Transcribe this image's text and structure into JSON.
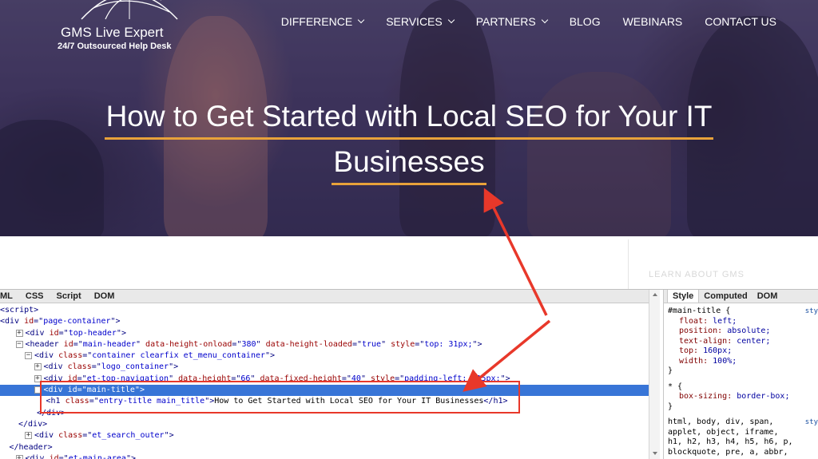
{
  "hero": {
    "logo": {
      "name": "GMS Live Expert",
      "tagline": "24/7 Outsourced Help Desk"
    },
    "nav": [
      {
        "label": "DIFFERENCE",
        "dropdown": true
      },
      {
        "label": "SERVICES",
        "dropdown": true
      },
      {
        "label": "PARTNERS",
        "dropdown": true
      },
      {
        "label": "BLOG",
        "dropdown": false
      },
      {
        "label": "WEBINARS",
        "dropdown": false
      },
      {
        "label": "CONTACT US",
        "dropdown": false
      }
    ],
    "title_lines": [
      "How to Get Started with Local SEO for Your IT",
      "Businesses"
    ]
  },
  "content_strip": {
    "faint_text": "LEARN ABOUT GMS"
  },
  "devtools": {
    "tabs": [
      "ML",
      "CSS",
      "Script",
      "DOM"
    ],
    "right_tabs": [
      "Style",
      "Computed",
      "DOM"
    ],
    "active_right_tab": "Style",
    "tree": [
      {
        "indent": 0,
        "exp": "",
        "parts": [
          [
            "tg",
            "<script>"
          ]
        ]
      },
      {
        "indent": 0,
        "exp": "",
        "parts": [
          [
            "tg",
            "<div "
          ],
          [
            "an",
            "id"
          ],
          [
            "tg",
            "=\""
          ],
          [
            "av",
            "page-container"
          ],
          [
            "tg",
            "\">"
          ]
        ]
      },
      {
        "indent": 1,
        "exp": "+",
        "parts": [
          [
            "tg",
            "<div "
          ],
          [
            "an",
            "id"
          ],
          [
            "tg",
            "=\""
          ],
          [
            "av",
            "top-header"
          ],
          [
            "tg",
            "\">"
          ]
        ]
      },
      {
        "indent": 1,
        "exp": "-",
        "parts": [
          [
            "tg",
            "<header "
          ],
          [
            "an",
            "id"
          ],
          [
            "tg",
            "=\""
          ],
          [
            "av",
            "main-header"
          ],
          [
            "tg",
            "\" "
          ],
          [
            "an",
            "data-height-onload"
          ],
          [
            "tg",
            "=\""
          ],
          [
            "av",
            "380"
          ],
          [
            "tg",
            "\" "
          ],
          [
            "an",
            "data-height-loaded"
          ],
          [
            "tg",
            "=\""
          ],
          [
            "av",
            "true"
          ],
          [
            "tg",
            "\" "
          ],
          [
            "an",
            "style"
          ],
          [
            "tg",
            "=\""
          ],
          [
            "av",
            "top: 31px;"
          ],
          [
            "tg",
            "\">"
          ]
        ]
      },
      {
        "indent": 2,
        "exp": "-",
        "parts": [
          [
            "tg",
            "<div "
          ],
          [
            "an",
            "class"
          ],
          [
            "tg",
            "=\""
          ],
          [
            "av",
            "container clearfix et_menu_container"
          ],
          [
            "tg",
            "\">"
          ]
        ]
      },
      {
        "indent": 3,
        "exp": "+",
        "parts": [
          [
            "tg",
            "<div "
          ],
          [
            "an",
            "class"
          ],
          [
            "tg",
            "=\""
          ],
          [
            "av",
            "logo_container"
          ],
          [
            "tg",
            "\">"
          ]
        ]
      },
      {
        "indent": 3,
        "exp": "+",
        "parts": [
          [
            "tg",
            "<div "
          ],
          [
            "an",
            "id"
          ],
          [
            "tg",
            "=\""
          ],
          [
            "av",
            "et-top-navigation"
          ],
          [
            "tg",
            "\" "
          ],
          [
            "an",
            "data-height"
          ],
          [
            "tg",
            "=\""
          ],
          [
            "av",
            "66"
          ],
          [
            "tg",
            "\" "
          ],
          [
            "an",
            "data-fixed-height"
          ],
          [
            "tg",
            "=\""
          ],
          [
            "av",
            "40"
          ],
          [
            "tg",
            "\" "
          ],
          [
            "an",
            "style"
          ],
          [
            "tg",
            "=\""
          ],
          [
            "av",
            "padding-left: 215px;"
          ],
          [
            "tg",
            "\">"
          ]
        ]
      },
      {
        "indent": 3,
        "exp": "-",
        "selected": true,
        "parts": [
          [
            "tg",
            "<div "
          ],
          [
            "an",
            "id"
          ],
          [
            "tg",
            "=\""
          ],
          [
            "av",
            "main-title"
          ],
          [
            "tg",
            "\">"
          ]
        ]
      },
      {
        "indent": 5,
        "exp": "",
        "parts": [
          [
            "tg",
            "<h1 "
          ],
          [
            "an",
            "class"
          ],
          [
            "tg",
            "=\""
          ],
          [
            "av",
            "entry-title main_title"
          ],
          [
            "tg",
            "\">"
          ],
          [
            "tx",
            "How to Get Started with Local SEO for Your IT Businesses"
          ],
          [
            "tg",
            "</h1>"
          ]
        ]
      },
      {
        "indent": 4,
        "exp": "",
        "parts": [
          [
            "tg",
            "</div>"
          ]
        ]
      },
      {
        "indent": 2,
        "exp": "",
        "parts": [
          [
            "tg",
            "</div>"
          ]
        ]
      },
      {
        "indent": 2,
        "exp": "+",
        "parts": [
          [
            "tg",
            "<div "
          ],
          [
            "an",
            "class"
          ],
          [
            "tg",
            "=\""
          ],
          [
            "av",
            "et_search_outer"
          ],
          [
            "tg",
            "\">"
          ]
        ]
      },
      {
        "indent": 1,
        "exp": "",
        "parts": [
          [
            "tg",
            "</header>"
          ]
        ]
      },
      {
        "indent": 1,
        "exp": "+",
        "parts": [
          [
            "tg",
            "<div "
          ],
          [
            "an",
            "id"
          ],
          [
            "tg",
            "=\""
          ],
          [
            "av",
            "et-main-area"
          ],
          [
            "tg",
            "\">"
          ]
        ]
      }
    ],
    "css_rules": [
      {
        "selector": "#main-title {",
        "props": [
          [
            "float",
            "left"
          ],
          [
            "position",
            "absolute"
          ],
          [
            "text-align",
            "center"
          ],
          [
            "top",
            "160px"
          ],
          [
            "width",
            "100%"
          ]
        ],
        "source": "sty"
      },
      {
        "selector": "* {",
        "props": [
          [
            "box-sizing",
            "border-box"
          ]
        ],
        "source": ""
      },
      {
        "selector": "html, body, div, span,",
        "props": [],
        "source": "sty",
        "extra": [
          "applet, object, iframe,",
          "h1, h2, h3, h4, h5, h6, p,",
          "blockquote, pre, a, abbr,"
        ]
      }
    ]
  }
}
